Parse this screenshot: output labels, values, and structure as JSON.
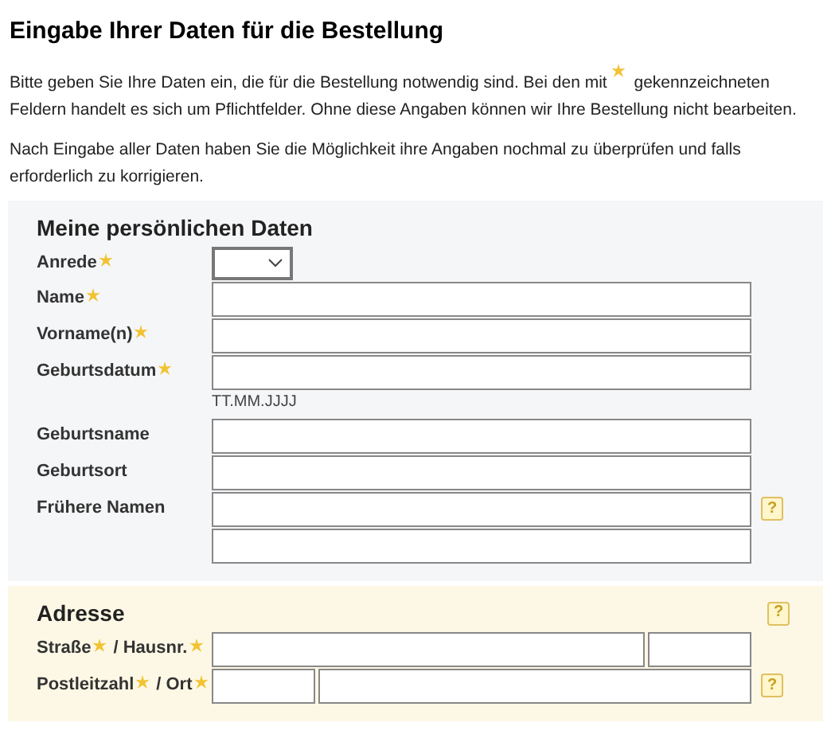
{
  "title": "Eingabe Ihrer Daten für die Bestellung",
  "intro": {
    "before": "Bitte geben Sie Ihre Daten ein, die für die Bestellung notwendig sind. Bei den mit",
    "after": "gekennzeichneten Feldern handelt es sich um Pflichtfelder. Ohne diese Angaben können wir Ihre Bestellung nicht bearbeiten."
  },
  "note": "Nach Eingabe aller Daten haben Sie die Möglichkeit ihre Angaben nochmal zu überprüfen und falls erforderlich zu korrigieren.",
  "sections": [
    {
      "heading": "Meine persönlichen Daten",
      "kind": "personal",
      "rows": [
        {
          "kind": "select",
          "label": [
            {
              "text": "Anrede",
              "required": true
            }
          ]
        },
        {
          "kind": "text",
          "label": [
            {
              "text": "Name",
              "required": true
            }
          ]
        },
        {
          "kind": "text",
          "label": [
            {
              "text": "Vorname(n)",
              "required": true
            }
          ]
        },
        {
          "kind": "text",
          "label": [
            {
              "text": "Geburtsdatum",
              "required": true
            }
          ],
          "hint": "TT.MM.JJJJ"
        },
        {
          "kind": "text",
          "label": [
            {
              "text": "Geburtsname",
              "required": false
            }
          ]
        },
        {
          "kind": "text",
          "label": [
            {
              "text": "Geburtsort",
              "required": false
            }
          ]
        },
        {
          "kind": "text",
          "label": [
            {
              "text": "Frühere Namen",
              "required": false
            }
          ],
          "help": "?"
        },
        {
          "kind": "text"
        }
      ]
    },
    {
      "heading": "Adresse",
      "kind": "address",
      "help": "?",
      "rows": [
        {
          "kind": "wide-narrow",
          "label": [
            {
              "text": "Straße",
              "required": true
            },
            {
              "text": "/ Hausnr.",
              "required": true
            }
          ]
        },
        {
          "kind": "narrow-wide",
          "label": [
            {
              "text": "Postleitzahl",
              "required": true
            },
            {
              "text": "/ Ort",
              "required": true
            }
          ],
          "help": "?"
        }
      ]
    }
  ]
}
